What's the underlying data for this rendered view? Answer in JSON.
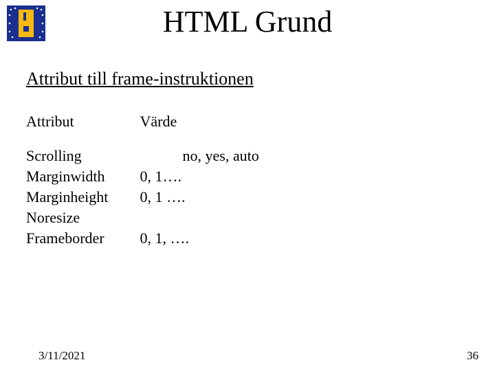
{
  "title": "HTML Grund",
  "subtitle": "Attribut till frame-instruktionen",
  "table": {
    "head": {
      "c1": "Attribut",
      "c2": "Värde"
    },
    "rows": [
      {
        "c1": "Scrolling",
        "c2": "no, yes, auto",
        "indent": true
      },
      {
        "c1": "Marginwidth",
        "c2": "0, 1….",
        "indent": false
      },
      {
        "c1": "Marginheight",
        "c2": "0, 1 ….",
        "indent": false
      },
      {
        "c1": "Noresize",
        "c2": "",
        "indent": false
      },
      {
        "c1": "Frameborder",
        "c2": "0, 1, ….",
        "indent": false
      }
    ]
  },
  "footer": {
    "date": "3/11/2021",
    "page": "36"
  }
}
